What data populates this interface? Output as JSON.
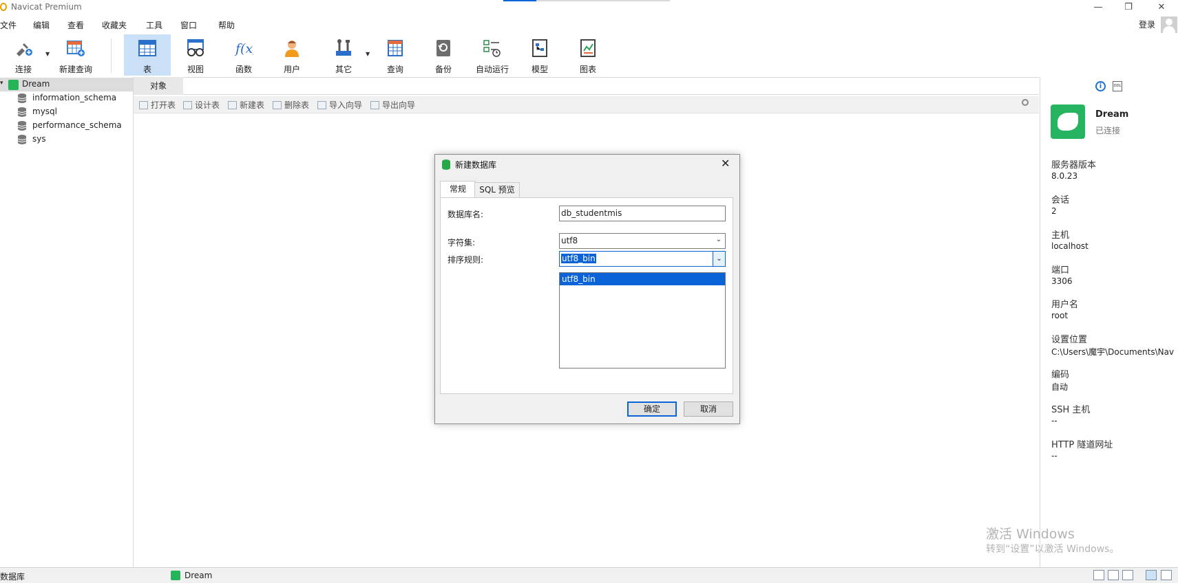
{
  "app": {
    "title": "Navicat Premium"
  },
  "menu": [
    "文件",
    "编辑",
    "查看",
    "收藏夹",
    "工具",
    "窗口",
    "帮助"
  ],
  "account": {
    "login_label": "登录"
  },
  "toolbar": {
    "connect": "连接",
    "new_query": "新建查询",
    "table": "表",
    "view": "视图",
    "function": "函数",
    "user": "用户",
    "other": "其它",
    "query": "查询",
    "backup": "备份",
    "autorun": "自动运行",
    "model": "模型",
    "chart": "图表"
  },
  "tree": {
    "connection": "Dream",
    "databases": [
      "information_schema",
      "mysql",
      "performance_schema",
      "sys"
    ]
  },
  "center": {
    "tab_label": "对象",
    "actions": [
      "打开表",
      "设计表",
      "新建表",
      "删除表",
      "导入向导",
      "导出向导"
    ]
  },
  "right_panel": {
    "name": "Dream",
    "status": "已连接",
    "fields": [
      {
        "label": "服务器版本",
        "value": "8.0.23"
      },
      {
        "label": "会话",
        "value": "2"
      },
      {
        "label": "主机",
        "value": "localhost"
      },
      {
        "label": "端口",
        "value": "3306"
      },
      {
        "label": "用户名",
        "value": "root"
      },
      {
        "label": "设置位置",
        "value": "C:\\Users\\魔宇\\Documents\\Nav"
      },
      {
        "label": "编码",
        "value": "自动"
      },
      {
        "label": "SSH 主机",
        "value": "--"
      },
      {
        "label": "HTTP 隧道网址",
        "value": "--"
      }
    ]
  },
  "dialog": {
    "title": "新建数据库",
    "tabs": {
      "general": "常规",
      "sql": "SQL 预览"
    },
    "db_name_label": "数据库名:",
    "db_name_value": "db_studentmis",
    "charset_label": "字符集:",
    "charset_value": "utf8",
    "collation_label": "排序规则:",
    "collation_value": "utf8_bin",
    "collation_options": [
      "utf8_bin"
    ],
    "ok": "确定",
    "cancel": "取消"
  },
  "statusbar": {
    "left": "数据库",
    "connection": "Dream"
  },
  "watermark": {
    "line1": "激活 Windows",
    "line2": "转到“设置”以激活 Windows。"
  }
}
